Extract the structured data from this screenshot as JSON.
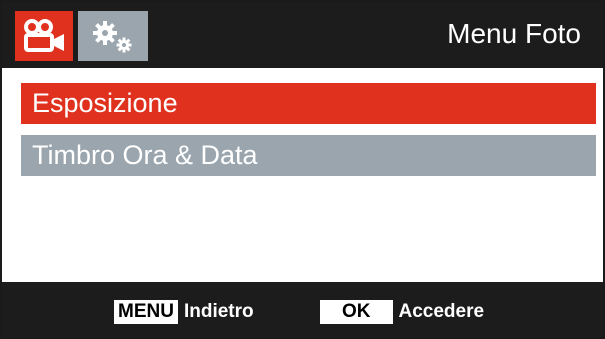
{
  "header": {
    "title": "Menu Foto",
    "tabs": [
      {
        "icon": "video-camera-icon",
        "active": true
      },
      {
        "icon": "gears-icon",
        "active": false
      }
    ]
  },
  "menu": {
    "items": [
      {
        "label": "Esposizione",
        "selected": true
      },
      {
        "label": "Timbro Ora & Data",
        "selected": false
      }
    ]
  },
  "footer": {
    "hints": [
      {
        "key": "MENU",
        "label": "Indietro"
      },
      {
        "key": "OK",
        "label": "Accedere"
      }
    ]
  },
  "colors": {
    "bar_background": "#1c1c1c",
    "accent_red": "#e0311f",
    "inactive_gray": "#9aa5ae"
  }
}
